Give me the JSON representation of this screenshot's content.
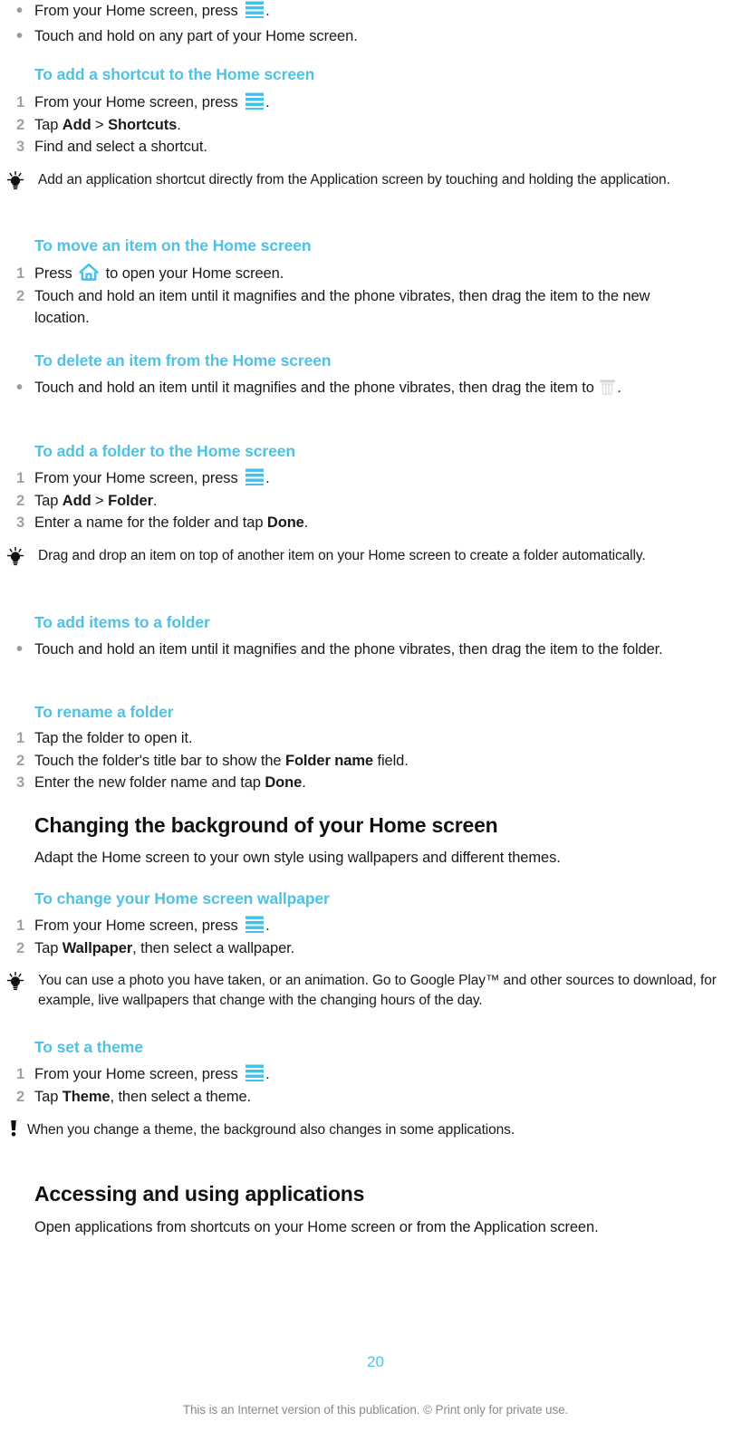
{
  "document": {
    "page_number": "20",
    "footer_note": "This is an Internet version of this publication. © Print only for private use.",
    "accent_color": "#4fc1e4",
    "marker_color": "#a0a0a0"
  },
  "icons": {
    "menu": "menu-icon",
    "home": "home-icon",
    "trash": "trash-icon",
    "tip": "lightbulb-tip-icon",
    "warning": "exclamation-warning-icon"
  },
  "blocks": [
    {
      "type": "bullet-list",
      "items": [
        {
          "pre": "From your Home screen, press ",
          "icon": "menu",
          "post": "."
        },
        {
          "pre": "Touch and hold on any part of your Home screen.",
          "icon": null,
          "post": ""
        }
      ]
    },
    {
      "type": "heading-sub",
      "text": "To add a shortcut to the Home screen"
    },
    {
      "type": "numbered-list",
      "items": [
        {
          "num": "1",
          "pre": "From your Home screen, press ",
          "icon": "menu",
          "post": "."
        },
        {
          "num": "2",
          "pre": "Tap ",
          "bold1": "Add",
          "mid": " > ",
          "bold2": "Shortcuts",
          "post": "."
        },
        {
          "num": "3",
          "pre": "Find and select a shortcut.",
          "icon": null,
          "post": ""
        }
      ]
    },
    {
      "type": "tip",
      "text": "Add an application shortcut directly from the Application screen by touching and holding the application."
    },
    {
      "type": "heading-sub",
      "text": "To move an item on the Home screen"
    },
    {
      "type": "numbered-list",
      "items": [
        {
          "num": "1",
          "pre": "Press ",
          "icon": "home",
          "post": " to open your Home screen."
        },
        {
          "num": "2",
          "pre": "Touch and hold an item until it magnifies and the phone vibrates, then drag the item to the new location.",
          "icon": null,
          "post": ""
        }
      ]
    },
    {
      "type": "heading-sub",
      "text": "To delete an item from the Home screen"
    },
    {
      "type": "bullet-list",
      "items": [
        {
          "pre": "Touch and hold an item until it magnifies and the phone vibrates, then drag the item to ",
          "icon": "trash",
          "post": "."
        }
      ]
    },
    {
      "type": "heading-sub",
      "text": "To add a folder to the Home screen"
    },
    {
      "type": "numbered-list",
      "items": [
        {
          "num": "1",
          "pre": "From your Home screen, press ",
          "icon": "menu",
          "post": "."
        },
        {
          "num": "2",
          "pre": "Tap ",
          "bold1": "Add",
          "mid": " > ",
          "bold2": "Folder",
          "post": "."
        },
        {
          "num": "3",
          "pre": "Enter a name for the folder and tap ",
          "bold1": "Done",
          "mid": "",
          "bold2": "",
          "post": "."
        }
      ]
    },
    {
      "type": "tip",
      "text": "Drag and drop an item on top of another item on your Home screen to create a folder automatically."
    },
    {
      "type": "heading-sub",
      "text": "To add items to a folder"
    },
    {
      "type": "bullet-list",
      "items": [
        {
          "pre": "Touch and hold an item until it magnifies and the phone vibrates, then drag the item to the folder.",
          "icon": null,
          "post": ""
        }
      ]
    },
    {
      "type": "heading-sub",
      "text": "To rename a folder"
    },
    {
      "type": "numbered-list",
      "items": [
        {
          "num": "1",
          "pre": "Tap the folder to open it.",
          "icon": null,
          "post": ""
        },
        {
          "num": "2",
          "pre": "Touch the folder's title bar to show the ",
          "bold1": "Folder name",
          "mid": "",
          "bold2": "",
          "post": " field."
        },
        {
          "num": "3",
          "pre": "Enter the new folder name and tap ",
          "bold1": "Done",
          "mid": "",
          "bold2": "",
          "post": "."
        }
      ]
    },
    {
      "type": "heading-main",
      "text": "Changing the background of your Home screen"
    },
    {
      "type": "paragraph",
      "text": "Adapt the Home screen to your own style using wallpapers and different themes."
    },
    {
      "type": "heading-sub",
      "text": "To change your Home screen wallpaper"
    },
    {
      "type": "numbered-list",
      "items": [
        {
          "num": "1",
          "pre": "From your Home screen, press ",
          "icon": "menu",
          "post": "."
        },
        {
          "num": "2",
          "pre": "Tap ",
          "bold1": "Wallpaper",
          "mid": "",
          "bold2": "",
          "post": ", then select a wallpaper."
        }
      ]
    },
    {
      "type": "tip",
      "text": "You can use a photo you have taken, or an animation. Go to Google Play™ and other sources to download, for example, live wallpapers that change with the changing hours of the day."
    },
    {
      "type": "heading-sub",
      "text": "To set a theme"
    },
    {
      "type": "numbered-list",
      "items": [
        {
          "num": "1",
          "pre": "From your Home screen, press ",
          "icon": "menu",
          "post": "."
        },
        {
          "num": "2",
          "pre": "Tap ",
          "bold1": "Theme",
          "mid": "",
          "bold2": "",
          "post": ", then select a theme."
        }
      ]
    },
    {
      "type": "warning",
      "text": "When you change a theme, the background also changes in some applications."
    },
    {
      "type": "heading-main",
      "text": "Accessing and using applications"
    },
    {
      "type": "paragraph",
      "text": "Open applications from shortcuts on your Home screen or from the Application screen."
    }
  ],
  "text": {
    "b1_1_pre": "From your Home screen, press ",
    "b1_1_post": ".",
    "b1_2": "Touch and hold on any part of your Home screen.",
    "h_shortcut": "To add a shortcut to the Home screen",
    "n1_1_pre": "From your Home screen, press ",
    "n1_1_post": ".",
    "n1_2_pre": "Tap ",
    "n1_2_b1": "Add",
    "n1_2_mid": " > ",
    "n1_2_b2": "Shortcuts",
    "n1_2_post": ".",
    "n1_3": "Find and select a shortcut.",
    "tip1": "Add an application shortcut directly from the Application screen by touching and holding the application.",
    "h_move": "To move an item on the Home screen",
    "n2_1_pre": "Press ",
    "n2_1_post": " to open your Home screen.",
    "n2_2": "Touch and hold an item until it magnifies and the phone vibrates, then drag the item to the new location.",
    "h_delete": "To delete an item from the Home screen",
    "b2_1_pre": "Touch and hold an item until it magnifies and the phone vibrates, then drag the item to ",
    "b2_1_post": ".",
    "h_folder": "To add a folder to the Home screen",
    "n3_1_pre": "From your Home screen, press ",
    "n3_1_post": ".",
    "n3_2_pre": "Tap ",
    "n3_2_b1": "Add",
    "n3_2_mid": " > ",
    "n3_2_b2": "Folder",
    "n3_2_post": ".",
    "n3_3_pre": "Enter a name for the folder and tap ",
    "n3_3_b1": "Done",
    "n3_3_post": ".",
    "tip2": "Drag and drop an item on top of another item on your Home screen to create a folder automatically.",
    "h_additems": "To add items to a folder",
    "b3_1": "Touch and hold an item until it magnifies and the phone vibrates, then drag the item to the folder.",
    "h_rename": "To rename a folder",
    "n4_1": "Tap the folder to open it.",
    "n4_2_pre": "Touch the folder's title bar to show the ",
    "n4_2_b1": "Folder name",
    "n4_2_post": " field.",
    "n4_3_pre": "Enter the new folder name and tap ",
    "n4_3_b1": "Done",
    "n4_3_post": ".",
    "h_changing": "Changing the background of your Home screen",
    "p_adapt": "Adapt the Home screen to your own style using wallpapers and different themes.",
    "h_wallpaper": "To change your Home screen wallpaper",
    "n5_1_pre": "From your Home screen, press ",
    "n5_1_post": ".",
    "n5_2_pre": "Tap ",
    "n5_2_b1": "Wallpaper",
    "n5_2_post": ", then select a wallpaper.",
    "tip3": "You can use a photo you have taken, or an animation. Go to Google Play™ and other sources to download, for example, live wallpapers that change with the changing hours of the day.",
    "h_theme": "To set a theme",
    "n6_1_pre": "From your Home screen, press ",
    "n6_1_post": ".",
    "n6_2_pre": "Tap ",
    "n6_2_b1": "Theme",
    "n6_2_post": ", then select a theme.",
    "warn1": "When you change a theme, the background also changes in some applications.",
    "h_accessing": "Accessing and using applications",
    "p_open": "Open applications from shortcuts on your Home screen or from the Application screen.",
    "num1": "1",
    "num2": "2",
    "num3": "3",
    "bullet": "•"
  }
}
